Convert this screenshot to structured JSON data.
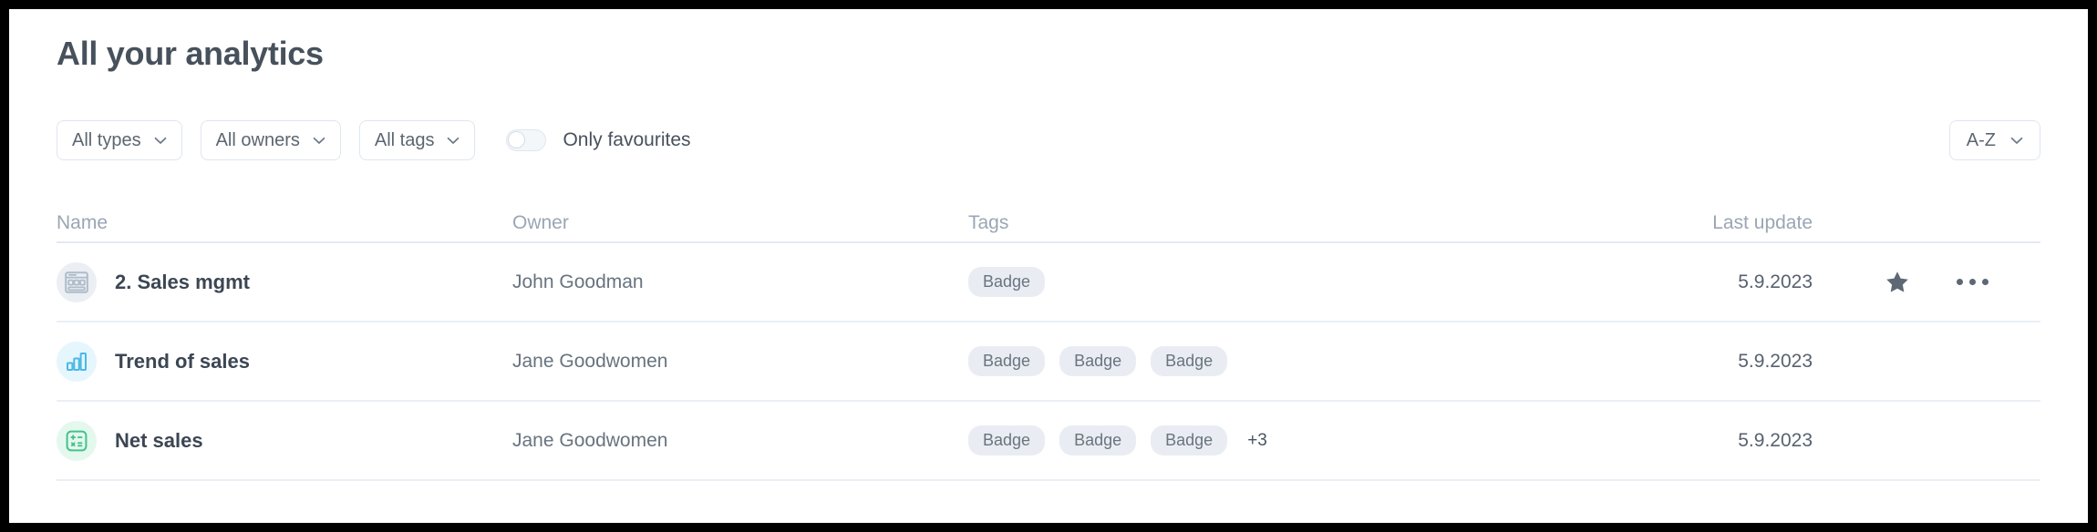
{
  "page": {
    "title": "All your analytics"
  },
  "filters": {
    "types": {
      "label": "All types",
      "icon": "chevron-down-icon"
    },
    "owners": {
      "label": "All owners",
      "icon": "chevron-down-icon"
    },
    "tags": {
      "label": "All tags",
      "icon": "chevron-down-icon"
    },
    "favourites_toggle": {
      "label": "Only favourites",
      "state": "off"
    },
    "sort": {
      "label": "A-Z",
      "icon": "chevron-down-icon"
    }
  },
  "table": {
    "columns": [
      "Name",
      "Owner",
      "Tags",
      "Last update"
    ],
    "rows": [
      {
        "icon": "dashboard-icon",
        "icon_color": "grey",
        "name": "2. Sales mgmt",
        "owner": "John Goodman",
        "tags": [
          "Badge"
        ],
        "overflow_tags": "",
        "last_update": "5.9.2023",
        "favourite": true,
        "actions_visible": true
      },
      {
        "icon": "bar-chart-icon",
        "icon_color": "blue",
        "name": "Trend of sales",
        "owner": "Jane Goodwomen",
        "tags": [
          "Badge",
          "Badge",
          "Badge"
        ],
        "overflow_tags": "",
        "last_update": "5.9.2023",
        "favourite": false,
        "actions_visible": false
      },
      {
        "icon": "calculator-icon",
        "icon_color": "green",
        "name": "Net sales",
        "owner": "Jane Goodwomen",
        "tags": [
          "Badge",
          "Badge",
          "Badge"
        ],
        "overflow_tags": "+3",
        "last_update": "5.9.2023",
        "favourite": false,
        "actions_visible": false
      }
    ]
  },
  "colors": {
    "title": "#47515c",
    "muted": "#9aa6b4",
    "badge_bg": "#e9edf3",
    "icon_grey": "#ebeef2",
    "icon_blue": "#e6f6fd",
    "icon_green": "#e4f8ee",
    "accent_blue": "#4ab8e8",
    "accent_green": "#44c28c",
    "border": "#dfe6ef"
  }
}
